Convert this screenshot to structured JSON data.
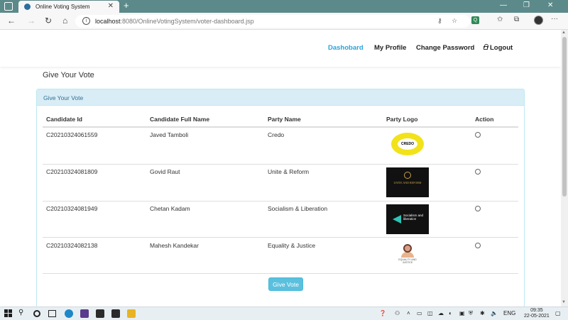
{
  "browser": {
    "tab_title": "Online Voting System",
    "tab_close": "✕",
    "new_tab": "+",
    "url_host": "localhost",
    "url_rest": ":8080/OnlineVotingSystem/voter-dashboard.jsp",
    "window_controls": [
      "—",
      "❐",
      "✕"
    ],
    "more": "···"
  },
  "nav": {
    "items": [
      {
        "label": "Dashobard",
        "active": true
      },
      {
        "label": "My Profile",
        "active": false
      },
      {
        "label": "Change Password",
        "active": false
      },
      {
        "label": "Logout",
        "active": false
      }
    ]
  },
  "page": {
    "title": "Give Your Vote",
    "panel_heading": "Give Your Vote"
  },
  "table": {
    "headers": [
      "Candidate Id",
      "Candidate Full Name",
      "Party Name",
      "Party Logo",
      "Action"
    ],
    "rows": [
      {
        "id": "C20210324061559",
        "name": "Javed Tamboli",
        "party": "Credo"
      },
      {
        "id": "C20210324081809",
        "name": "Govid Raut",
        "party": "Unite & Reform"
      },
      {
        "id": "C20210324081949",
        "name": "Chetan Kadam",
        "party": "Socialism & Liberation"
      },
      {
        "id": "C20210324082138",
        "name": "Mahesh Kandekar",
        "party": "Equality & Justice"
      }
    ]
  },
  "logos": {
    "credo": "CREDO",
    "unite": "UNITE AND REFORM",
    "socialism": "Socialism and liberation",
    "equality": "EQUALITY AND JUSTICE"
  },
  "actions": {
    "vote_button": "Give Vote"
  },
  "taskbar": {
    "language": "ENG",
    "time": "09:35",
    "date": "22-05-2021"
  },
  "colors": {
    "accent": "#2aa3d9",
    "panel_bg": "#d9edf7",
    "panel_text": "#31708f",
    "button": "#5bc0de",
    "tabstrip": "#5c8a8a"
  }
}
